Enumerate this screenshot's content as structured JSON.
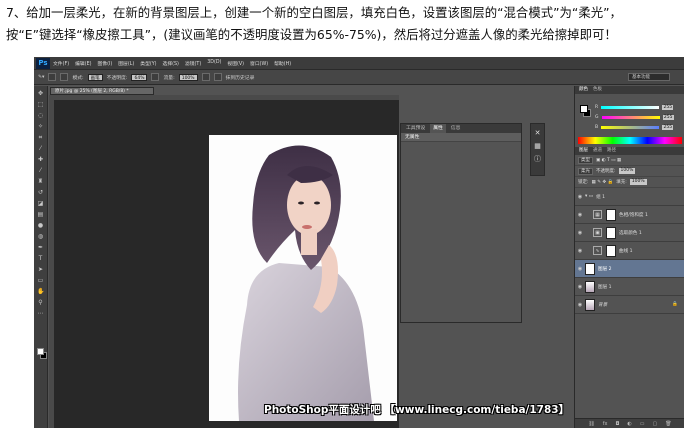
{
  "caption": {
    "line1": "7、给加一层柔光，在新的背景图层上，创建一个新的空白图层，填充白色，设置该图层的“混合模式”为“柔光”，",
    "line2": "按“E”键选择“橡皮擦工具”，(建议画笔的不透明度设置为65%-75%)，然后将过分遮盖人像的柔光给擦掉即可！"
  },
  "app": {
    "logo": "Ps",
    "menu": [
      "文件(F)",
      "编辑(E)",
      "图像(I)",
      "图层(L)",
      "类型(Y)",
      "选择(S)",
      "滤镜(T)",
      "3D(D)",
      "视图(V)",
      "窗口(W)",
      "帮助(H)"
    ],
    "workspace": "基本功能"
  },
  "options": {
    "mode_label": "模式:",
    "mode_value": "画笔",
    "opacity_label": "不透明度:",
    "opacity_value": "64%",
    "flow_label": "流量:",
    "flow_value": "100%",
    "history_label": "抹到历史记录"
  },
  "doc": {
    "tab_label": "原片.jpg @ 25% (图层 2, RGB/8) *"
  },
  "history_panel": {
    "tabs": [
      "工具预设",
      "属性",
      "信息"
    ],
    "active_tab": "属性",
    "row": "无属性"
  },
  "color_panel": {
    "tabs": [
      "颜色",
      "色板"
    ],
    "sliders": [
      {
        "label": "R",
        "value": "255",
        "color": "#ff3a3a"
      },
      {
        "label": "G",
        "value": "255",
        "color": "#e6ff3a"
      },
      {
        "label": "B",
        "value": "255",
        "color": "#5a7dff"
      }
    ]
  },
  "layers_panel": {
    "tabs": [
      "图层",
      "通道",
      "路径"
    ],
    "kind_label": "类型",
    "blend_mode": "柔光",
    "opacity_label": "不透明度:",
    "opacity_value": "100%",
    "lock_label": "锁定:",
    "fill_label": "填充:",
    "fill_value": "100%",
    "group_name": "组 1",
    "layers": [
      {
        "name": "色相/饱和度 1",
        "type": "adjustment"
      },
      {
        "name": "选取颜色 1",
        "type": "adjustment"
      },
      {
        "name": "曲线 1",
        "type": "adjustment"
      },
      {
        "name": "图层 2",
        "type": "pixel",
        "selected": true
      },
      {
        "name": "图层 1",
        "type": "photo"
      },
      {
        "name": "背景",
        "type": "photo"
      }
    ]
  },
  "watermark": "PhotoShop平面设计吧 【www.linecg.com/tieba/1783】"
}
